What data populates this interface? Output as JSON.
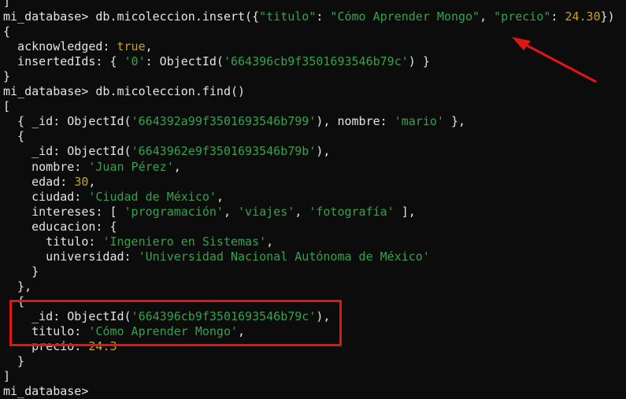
{
  "terminal": {
    "lines": [
      [
        {
          "t": "]",
          "c": "p"
        }
      ],
      [
        {
          "t": "mi_database> db.micoleccion.insert({",
          "c": "p"
        },
        {
          "t": "\"titulo\"",
          "c": "s"
        },
        {
          "t": ": ",
          "c": "p"
        },
        {
          "t": "\"Cómo Aprender Mongo\"",
          "c": "s"
        },
        {
          "t": ", ",
          "c": "p"
        },
        {
          "t": "\"precio\"",
          "c": "s"
        },
        {
          "t": ": ",
          "c": "p"
        },
        {
          "t": "24.30",
          "c": "n"
        },
        {
          "t": "})",
          "c": "p"
        }
      ],
      [
        {
          "t": "{",
          "c": "p"
        }
      ],
      [
        {
          "t": "  acknowledged: ",
          "c": "p"
        },
        {
          "t": "true",
          "c": "b"
        },
        {
          "t": ",",
          "c": "p"
        }
      ],
      [
        {
          "t": "  insertedIds: { ",
          "c": "p"
        },
        {
          "t": "'0'",
          "c": "s"
        },
        {
          "t": ": ObjectId(",
          "c": "p"
        },
        {
          "t": "'664396cb9f3501693546b79c'",
          "c": "s"
        },
        {
          "t": ") }",
          "c": "p"
        }
      ],
      [
        {
          "t": "}",
          "c": "p"
        }
      ],
      [
        {
          "t": "mi_database> db.micoleccion.find()",
          "c": "p"
        }
      ],
      [
        {
          "t": "[",
          "c": "p"
        }
      ],
      [
        {
          "t": "  { _id: ObjectId(",
          "c": "p"
        },
        {
          "t": "'664392a99f3501693546b799'",
          "c": "s"
        },
        {
          "t": "), nombre: ",
          "c": "p"
        },
        {
          "t": "'mario'",
          "c": "s"
        },
        {
          "t": " },",
          "c": "p"
        }
      ],
      [
        {
          "t": "  {",
          "c": "p"
        }
      ],
      [
        {
          "t": "    _id: ObjectId(",
          "c": "p"
        },
        {
          "t": "'6643962e9f3501693546b79b'",
          "c": "s"
        },
        {
          "t": "),",
          "c": "p"
        }
      ],
      [
        {
          "t": "    nombre: ",
          "c": "p"
        },
        {
          "t": "'Juan Pérez'",
          "c": "s"
        },
        {
          "t": ",",
          "c": "p"
        }
      ],
      [
        {
          "t": "    edad: ",
          "c": "p"
        },
        {
          "t": "30",
          "c": "n"
        },
        {
          "t": ",",
          "c": "p"
        }
      ],
      [
        {
          "t": "    ciudad: ",
          "c": "p"
        },
        {
          "t": "'Ciudad de México'",
          "c": "s"
        },
        {
          "t": ",",
          "c": "p"
        }
      ],
      [
        {
          "t": "    intereses: [ ",
          "c": "p"
        },
        {
          "t": "'programación'",
          "c": "s"
        },
        {
          "t": ", ",
          "c": "p"
        },
        {
          "t": "'viajes'",
          "c": "s"
        },
        {
          "t": ", ",
          "c": "p"
        },
        {
          "t": "'fotografía'",
          "c": "s"
        },
        {
          "t": " ],",
          "c": "p"
        }
      ],
      [
        {
          "t": "    educacion: {",
          "c": "p"
        }
      ],
      [
        {
          "t": "      titulo: ",
          "c": "p"
        },
        {
          "t": "'Ingeniero en Sistemas'",
          "c": "s"
        },
        {
          "t": ",",
          "c": "p"
        }
      ],
      [
        {
          "t": "      universidad: ",
          "c": "p"
        },
        {
          "t": "'Universidad Nacional Autónoma de México'",
          "c": "s"
        }
      ],
      [
        {
          "t": "    }",
          "c": "p"
        }
      ],
      [
        {
          "t": "  },",
          "c": "p"
        }
      ],
      [
        {
          "t": "  {",
          "c": "p"
        }
      ],
      [
        {
          "t": "    _id: ObjectId(",
          "c": "p"
        },
        {
          "t": "'664396cb9f3501693546b79c'",
          "c": "s"
        },
        {
          "t": "),",
          "c": "p"
        }
      ],
      [
        {
          "t": "    titulo: ",
          "c": "p"
        },
        {
          "t": "'Cómo Aprender Mongo'",
          "c": "s"
        },
        {
          "t": ",",
          "c": "p"
        }
      ],
      [
        {
          "t": "    precio: ",
          "c": "p"
        },
        {
          "t": "24.3",
          "c": "n"
        }
      ],
      [
        {
          "t": "  }",
          "c": "p"
        }
      ],
      [
        {
          "t": "]",
          "c": "p"
        }
      ],
      [
        {
          "t": "mi_database>",
          "c": "p"
        }
      ]
    ]
  },
  "colors": {
    "background": "#0c0c0c",
    "text": "#e4e4e4",
    "string": "#34a24a",
    "number": "#c8a21c",
    "annotation": "#e01515"
  },
  "annotations": {
    "highlight_box": "red-rectangle",
    "pointer": "red-arrow"
  }
}
